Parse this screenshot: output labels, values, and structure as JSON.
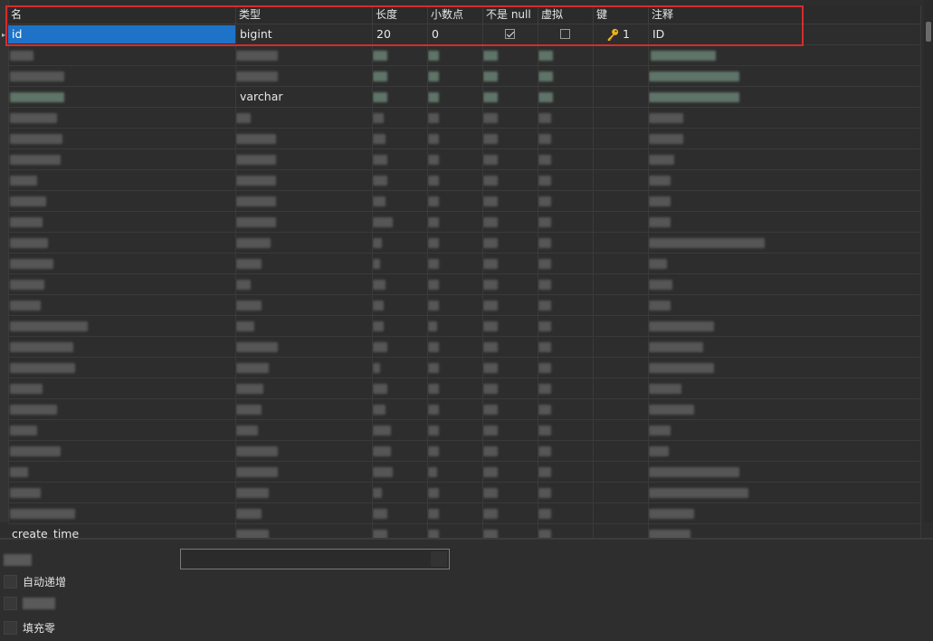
{
  "table": {
    "columns": [
      "名",
      "类型",
      "长度",
      "小数点",
      "不是 null",
      "虚拟",
      "键",
      "注释"
    ],
    "rows": [
      {
        "name": "id",
        "type": "bigint",
        "length": "20",
        "decimals": "0",
        "not_null": true,
        "virtual": false,
        "key": "1",
        "comment": "ID"
      },
      {
        "name": "",
        "type": "",
        "length": "",
        "decimals": "",
        "not_null": false,
        "virtual": false,
        "key": "",
        "comment": ""
      },
      {
        "name": "",
        "type": "",
        "length": "",
        "decimals": "",
        "not_null": false,
        "virtual": false,
        "key": "",
        "comment": ""
      },
      {
        "name": "",
        "type": "varchar",
        "length": "",
        "decimals": "",
        "not_null": false,
        "virtual": false,
        "key": "",
        "comment": ""
      },
      {
        "name": "",
        "type": "",
        "length": "",
        "decimals": "",
        "not_null": false,
        "virtual": false,
        "key": "",
        "comment": ""
      },
      {
        "name": "",
        "type": "",
        "length": "",
        "decimals": "",
        "not_null": false,
        "virtual": false,
        "key": "",
        "comment": ""
      },
      {
        "name": "",
        "type": "",
        "length": "",
        "decimals": "",
        "not_null": false,
        "virtual": false,
        "key": "",
        "comment": ""
      },
      {
        "name": "",
        "type": "",
        "length": "",
        "decimals": "",
        "not_null": false,
        "virtual": false,
        "key": "",
        "comment": ""
      },
      {
        "name": "",
        "type": "",
        "length": "",
        "decimals": "",
        "not_null": false,
        "virtual": false,
        "key": "",
        "comment": ""
      },
      {
        "name": "",
        "type": "",
        "length": "",
        "decimals": "",
        "not_null": false,
        "virtual": false,
        "key": "",
        "comment": ""
      },
      {
        "name": "",
        "type": "",
        "length": "",
        "decimals": "",
        "not_null": false,
        "virtual": false,
        "key": "",
        "comment": ""
      },
      {
        "name": "",
        "type": "",
        "length": "",
        "decimals": "",
        "not_null": false,
        "virtual": false,
        "key": "",
        "comment": ""
      },
      {
        "name": "",
        "type": "",
        "length": "",
        "decimals": "",
        "not_null": false,
        "virtual": false,
        "key": "",
        "comment": ""
      },
      {
        "name": "",
        "type": "",
        "length": "",
        "decimals": "",
        "not_null": false,
        "virtual": false,
        "key": "",
        "comment": ""
      },
      {
        "name": "",
        "type": "",
        "length": "",
        "decimals": "",
        "not_null": false,
        "virtual": false,
        "key": "",
        "comment": ""
      },
      {
        "name": "",
        "type": "",
        "length": "",
        "decimals": "",
        "not_null": false,
        "virtual": false,
        "key": "",
        "comment": ""
      },
      {
        "name": "",
        "type": "",
        "length": "",
        "decimals": "",
        "not_null": false,
        "virtual": false,
        "key": "",
        "comment": ""
      },
      {
        "name": "",
        "type": "",
        "length": "",
        "decimals": "",
        "not_null": false,
        "virtual": false,
        "key": "",
        "comment": ""
      },
      {
        "name": "",
        "type": "",
        "length": "",
        "decimals": "",
        "not_null": false,
        "virtual": false,
        "key": "",
        "comment": ""
      },
      {
        "name": "",
        "type": "",
        "length": "",
        "decimals": "",
        "not_null": false,
        "virtual": false,
        "key": "",
        "comment": ""
      },
      {
        "name": "",
        "type": "",
        "length": "",
        "decimals": "",
        "not_null": false,
        "virtual": false,
        "key": "",
        "comment": ""
      },
      {
        "name": "",
        "type": "",
        "length": "",
        "decimals": "",
        "not_null": false,
        "virtual": false,
        "key": "",
        "comment": ""
      },
      {
        "name": "",
        "type": "",
        "length": "",
        "decimals": "",
        "not_null": false,
        "virtual": false,
        "key": "",
        "comment": ""
      },
      {
        "name": "",
        "type": "",
        "length": "",
        "decimals": "",
        "not_null": false,
        "virtual": false,
        "key": "",
        "comment": ""
      },
      {
        "name": "create_time",
        "type": "",
        "length": "",
        "decimals": "",
        "not_null": false,
        "virtual": false,
        "key": "",
        "comment": ""
      }
    ]
  },
  "options": {
    "auto_increment": "自动递增",
    "zerofill": "填充零"
  },
  "colors": {
    "selection": "#1e73c8",
    "highlight_box": "#d62b2b",
    "key_icon": "#f0b41c",
    "background": "#2d2d2d"
  },
  "icons": {
    "key": "key-icon",
    "checkbox": "checkbox"
  }
}
